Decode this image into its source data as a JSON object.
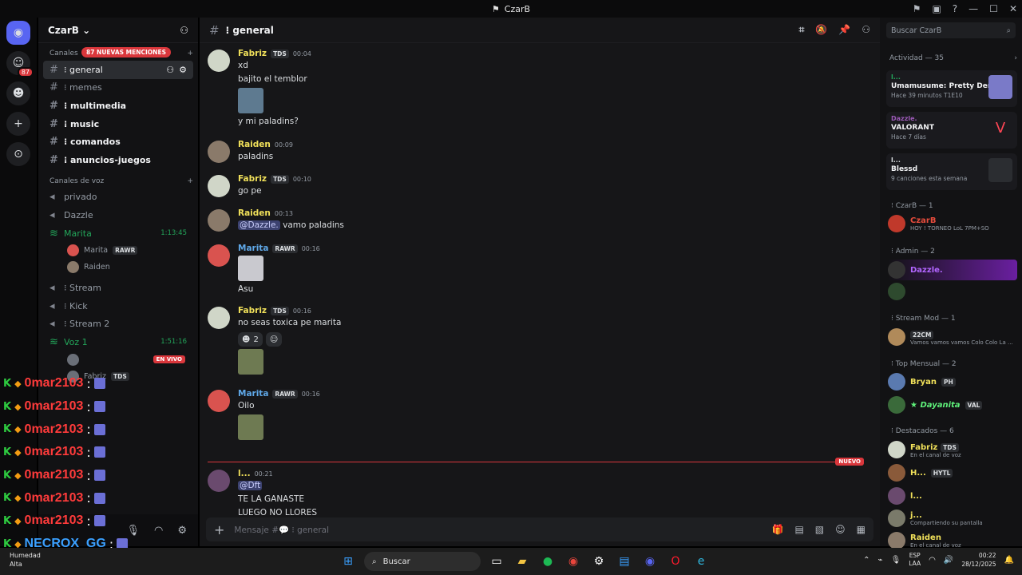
{
  "window": {
    "title": "CzarB"
  },
  "rail": {
    "mention_count": "87"
  },
  "server": {
    "name": "CzarB"
  },
  "sidebar": {
    "text_category_label": "Canales",
    "mentions_pill": "87 NUEVAS MENCIONES",
    "channels": [
      {
        "name": "⁝ general"
      },
      {
        "name": "⁝ memes"
      },
      {
        "name": "⁝ multimedia"
      },
      {
        "name": "⁝ music"
      },
      {
        "name": "⁝ comandos"
      },
      {
        "name": "⁝ anuncios-juegos"
      }
    ],
    "voice_category_label": "Canales de voz",
    "voice_channels": {
      "privado": "privado",
      "dazzle": "Dazzle",
      "marita": "Marita",
      "marita_timer": "1:13:45",
      "marita_users": [
        {
          "name": "Marita",
          "tag": "RAWR"
        },
        {
          "name": "Raiden",
          "tag": ""
        }
      ],
      "stream": "⁝ Stream",
      "kick": "⁝ Kick",
      "stream2": "⁝ Stream 2",
      "voz1": "Voz 1",
      "voz1_timer": "1:51:16",
      "live_badge": "EN VIVO",
      "voz1_user2": "Fabriz",
      "voz1_user2_tag": "TDS"
    }
  },
  "overlay": {
    "lines": [
      {
        "name": "0mar2103",
        "color": "red"
      },
      {
        "name": "0mar2103",
        "color": "red"
      },
      {
        "name": "0mar2103",
        "color": "red"
      },
      {
        "name": "0mar2103",
        "color": "red"
      },
      {
        "name": "0mar2103",
        "color": "red"
      },
      {
        "name": "0mar2103",
        "color": "red"
      },
      {
        "name": "0mar2103",
        "color": "red"
      },
      {
        "name": "NECROX_GG",
        "color": "blue"
      },
      {
        "name": "NECROX_GG",
        "color": "blue"
      }
    ]
  },
  "chat": {
    "channel": "⁝ general",
    "new_badge": "NUEVO",
    "composer_placeholder": "Mensaje #💬 ⁝ general",
    "messages": [
      {
        "author": "Fabriz",
        "tag": "TDS",
        "time": "00:04",
        "color": "#f0e05a",
        "lines": [
          "xd",
          "bajito el temblor"
        ],
        "extra": "y mi paladins?"
      },
      {
        "author": "Raiden",
        "tag": "",
        "time": "00:09",
        "color": "#f0e05a",
        "lines": [
          "paladins"
        ]
      },
      {
        "author": "Fabriz",
        "tag": "TDS",
        "time": "00:10",
        "color": "#f0e05a",
        "lines": [
          "go pe"
        ]
      },
      {
        "author": "Raiden",
        "tag": "",
        "time": "00:13",
        "color": "#f0e05a",
        "mention": "@Dazzle.",
        "lines": [
          "vamo paladins"
        ]
      },
      {
        "author": "Marita",
        "tag": "RAWR",
        "time": "00:16",
        "color": "#5fa8e8",
        "lines": [
          "Asu"
        ]
      },
      {
        "author": "Fabriz",
        "tag": "TDS",
        "time": "00:16",
        "color": "#f0e05a",
        "lines": [
          "no seas toxica pe marita"
        ],
        "reaction_count": "2"
      },
      {
        "author": "Marita",
        "tag": "RAWR",
        "time": "00:16",
        "color": "#5fa8e8",
        "lines": [
          "Oilo"
        ]
      },
      {
        "author": "l...",
        "tag": "",
        "time": "00:21",
        "color": "#f0e05a",
        "mention": "@Dft",
        "lines": [
          "TE LA GANASTE",
          "LUEGO NO LLORES"
        ]
      }
    ]
  },
  "right": {
    "search_placeholder": "Buscar CzarB",
    "activity_title": "Actividad — 35",
    "activities": [
      {
        "user": "l...",
        "game": "Umamusume: Pretty Derby",
        "sub": "Hace 39 minutos  T1E10"
      },
      {
        "user": "Dazzle.",
        "game": "VALORANT",
        "sub": "Hace 7 días"
      },
      {
        "user": "l...",
        "game": "Blessd",
        "sub": "9 canciones esta semana"
      }
    ],
    "roles": {
      "czarb": "⁝ CzarB — 1",
      "admin": "⁝ Admin — 2",
      "streammod": "⁝ Stream Mod — 1",
      "topmensual": "⁝ Top Mensual — 2",
      "destacados": "⁝ Destacados — 6"
    },
    "members": {
      "czarb": {
        "name": "CzarB",
        "status": "HOY ! TORNEO LoL 7PM+SO"
      },
      "dazzle": {
        "name": "Dazzle."
      },
      "mod_tag": "22CM",
      "mod_status": "Vamos vamos vamos Colo Colo La ...",
      "bryan": {
        "name": "Bryan",
        "tag": "PH"
      },
      "dayanita": {
        "name": "★ Dayanita",
        "tag": "VAL"
      },
      "fabriz": {
        "name": "Fabriz",
        "tag": "TDS",
        "status": "En el canal de voz"
      },
      "h": {
        "name": "H...",
        "tag": "HYTL"
      },
      "l": {
        "name": "l..."
      },
      "j": {
        "name": "j...",
        "status": "Compartiendo su pantalla"
      },
      "raiden": {
        "name": "Raiden",
        "status": "En el canal de voz"
      }
    }
  },
  "taskbar": {
    "search": "Buscar",
    "weather_temp": "Humedad",
    "weather_sub": "Alta",
    "lang_top": "ESP",
    "lang_bottom": "LAA",
    "time": "00:22",
    "date": "28/12/2025"
  }
}
